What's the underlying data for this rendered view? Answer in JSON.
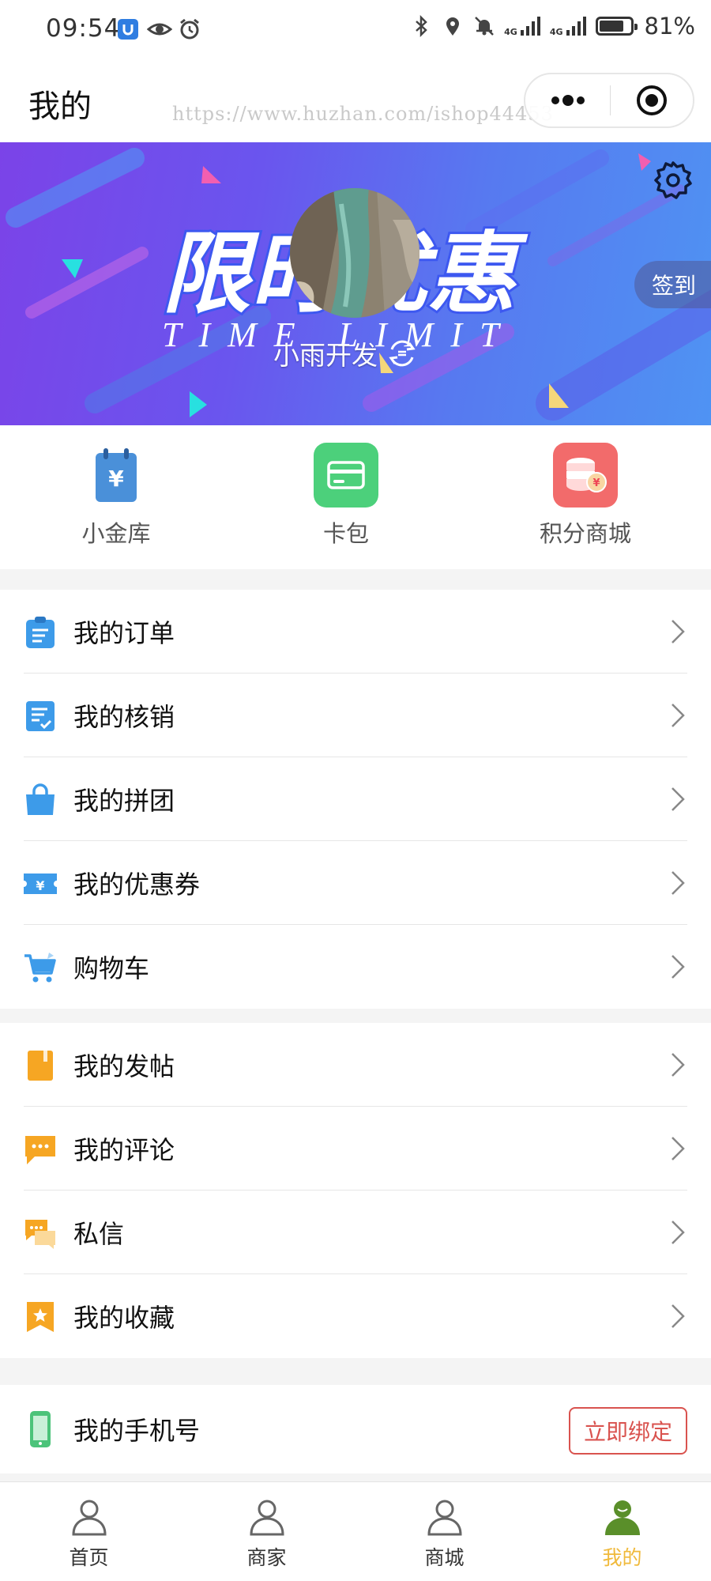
{
  "status_bar": {
    "time": "09:54",
    "net_left": "4G",
    "net_right": "4G",
    "battery_percent": "81%",
    "battery_level": 0.81
  },
  "header": {
    "title": "我的",
    "watermark": "https://www.huzhan.com/ishop44453"
  },
  "banner": {
    "background_text": "限时优惠",
    "background_subtext": "TIME LIMIT",
    "nickname": "小雨开发",
    "checkin_label": "签到"
  },
  "quick_entries": [
    {
      "label": "小金库",
      "icon": "vault-icon",
      "color": "#4a90d9"
    },
    {
      "label": "卡包",
      "icon": "card-wallet-icon",
      "color": "#4cd07b"
    },
    {
      "label": "积分商城",
      "icon": "points-mall-icon",
      "color": "#f25c5c"
    }
  ],
  "section1": [
    {
      "label": "我的订单",
      "icon": "order-clipboard-icon"
    },
    {
      "label": "我的核销",
      "icon": "verification-doc-icon"
    },
    {
      "label": "我的拼团",
      "icon": "group-buy-bag-icon"
    },
    {
      "label": "我的优惠券",
      "icon": "coupon-ticket-icon"
    },
    {
      "label": "购物车",
      "icon": "shopping-cart-icon"
    }
  ],
  "section2": [
    {
      "label": "我的发帖",
      "icon": "post-book-icon"
    },
    {
      "label": "我的评论",
      "icon": "comment-bubble-icon"
    },
    {
      "label": "私信",
      "icon": "private-message-icon"
    },
    {
      "label": "我的收藏",
      "icon": "favorite-bookmark-icon"
    }
  ],
  "phone": {
    "label": "我的手机号",
    "bind_label": "立即绑定",
    "icon": "mobile-phone-icon"
  },
  "tabs": [
    {
      "label": "首页",
      "icon": "home-person-icon",
      "active": false
    },
    {
      "label": "商家",
      "icon": "merchant-person-icon",
      "active": false
    },
    {
      "label": "商城",
      "icon": "mall-person-icon",
      "active": false
    },
    {
      "label": "我的",
      "icon": "mine-person-icon",
      "active": true
    }
  ],
  "colors": {
    "blue_icon": "#3d9be9",
    "orange_icon": "#f6a623",
    "green_icon": "#4cc37a",
    "active_tab": "#f0b93a",
    "bind_red": "#d9534f"
  }
}
